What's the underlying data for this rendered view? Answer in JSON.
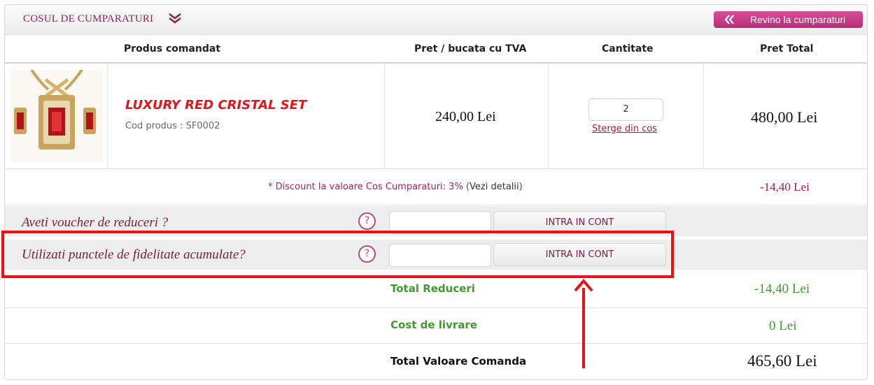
{
  "header": {
    "cart_title": "COSUL DE CUMPARATURI",
    "back_button_label": "Revino la cumparaturi"
  },
  "columns": {
    "product": "Produs comandat",
    "unit_price": "Pret / bucata cu TVA",
    "quantity": "Cantitate",
    "total": "Pret Total"
  },
  "item": {
    "name": "LUXURY RED CRISTAL SET",
    "code_label": "Cod produs : ",
    "code": "SF0002",
    "unit_price": "240,00",
    "currency": "Lei",
    "quantity": "2",
    "remove_label": "Sterge din cos",
    "total_price": "480,00"
  },
  "discount": {
    "text": "* Discount la valoare Cos Cumparaturi: 3% (",
    "details_link": "Vezi detalii",
    "close_paren": ")",
    "value": "-14,40 Lei"
  },
  "voucher": {
    "question": "Aveti voucher de reduceri ?",
    "help": "?",
    "button_label": "INTRA IN CONT"
  },
  "loyalty": {
    "question": "Utilizati punctele de fidelitate acumulate?",
    "help": "?",
    "button_label": "INTRA IN CONT"
  },
  "totals": {
    "discounts_label": "Total Reduceri",
    "discounts_value": "-14,40 Lei",
    "shipping_label": "Cost de livrare",
    "shipping_value": "0 Lei",
    "order_total_label": "Total Valoare Comanda",
    "order_total_value": "465,60 Lei"
  },
  "colors": {
    "brand": "#8a2357",
    "button_pink": "#c93a86",
    "product_red": "#e8141b",
    "green": "#3f9a2c",
    "highlight_red": "#ee1111"
  }
}
